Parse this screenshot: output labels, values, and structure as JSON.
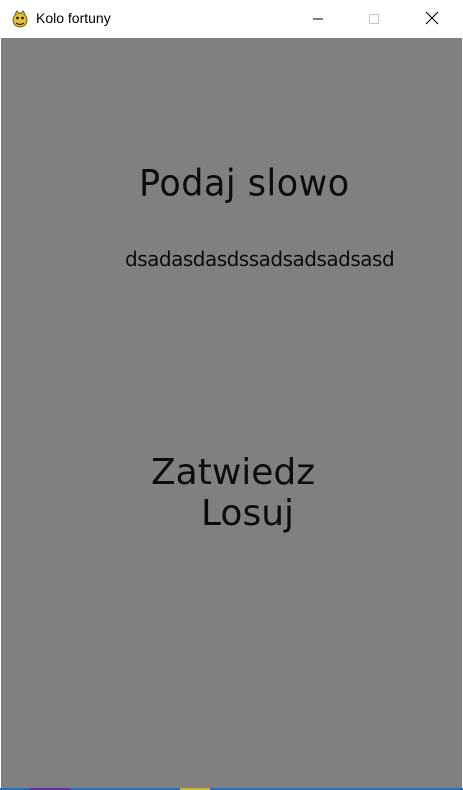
{
  "window": {
    "title": "Kolo fortuny",
    "icon": "pygame-snake-icon",
    "controls": [
      "minimize-icon",
      "maximize-icon",
      "close-icon"
    ]
  },
  "content": {
    "heading": "Podaj slowo",
    "entered_text": "dsadasdasdssadsadsadsasd",
    "confirm_label": "Zatwiedz",
    "draw_label": "Losuj"
  },
  "colors": {
    "background": "#808080",
    "text": "#0c0c0c"
  }
}
